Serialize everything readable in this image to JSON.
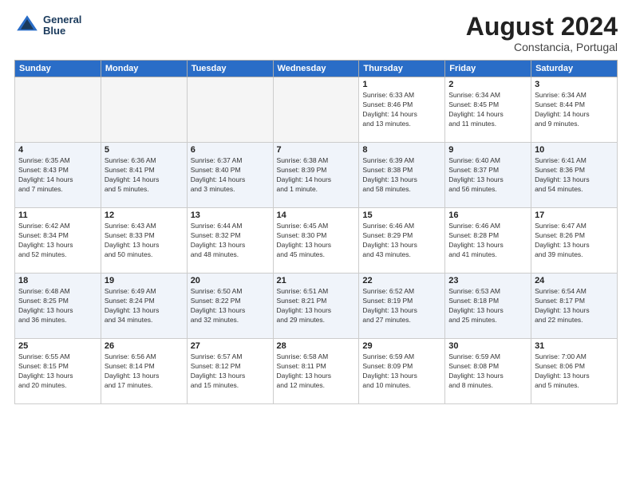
{
  "header": {
    "logo_line1": "General",
    "logo_line2": "Blue",
    "title": "August 2024",
    "location": "Constancia, Portugal"
  },
  "weekdays": [
    "Sunday",
    "Monday",
    "Tuesday",
    "Wednesday",
    "Thursday",
    "Friday",
    "Saturday"
  ],
  "weeks": [
    [
      {
        "day": "",
        "info": ""
      },
      {
        "day": "",
        "info": ""
      },
      {
        "day": "",
        "info": ""
      },
      {
        "day": "",
        "info": ""
      },
      {
        "day": "1",
        "info": "Sunrise: 6:33 AM\nSunset: 8:46 PM\nDaylight: 14 hours\nand 13 minutes."
      },
      {
        "day": "2",
        "info": "Sunrise: 6:34 AM\nSunset: 8:45 PM\nDaylight: 14 hours\nand 11 minutes."
      },
      {
        "day": "3",
        "info": "Sunrise: 6:34 AM\nSunset: 8:44 PM\nDaylight: 14 hours\nand 9 minutes."
      }
    ],
    [
      {
        "day": "4",
        "info": "Sunrise: 6:35 AM\nSunset: 8:43 PM\nDaylight: 14 hours\nand 7 minutes."
      },
      {
        "day": "5",
        "info": "Sunrise: 6:36 AM\nSunset: 8:41 PM\nDaylight: 14 hours\nand 5 minutes."
      },
      {
        "day": "6",
        "info": "Sunrise: 6:37 AM\nSunset: 8:40 PM\nDaylight: 14 hours\nand 3 minutes."
      },
      {
        "day": "7",
        "info": "Sunrise: 6:38 AM\nSunset: 8:39 PM\nDaylight: 14 hours\nand 1 minute."
      },
      {
        "day": "8",
        "info": "Sunrise: 6:39 AM\nSunset: 8:38 PM\nDaylight: 13 hours\nand 58 minutes."
      },
      {
        "day": "9",
        "info": "Sunrise: 6:40 AM\nSunset: 8:37 PM\nDaylight: 13 hours\nand 56 minutes."
      },
      {
        "day": "10",
        "info": "Sunrise: 6:41 AM\nSunset: 8:36 PM\nDaylight: 13 hours\nand 54 minutes."
      }
    ],
    [
      {
        "day": "11",
        "info": "Sunrise: 6:42 AM\nSunset: 8:34 PM\nDaylight: 13 hours\nand 52 minutes."
      },
      {
        "day": "12",
        "info": "Sunrise: 6:43 AM\nSunset: 8:33 PM\nDaylight: 13 hours\nand 50 minutes."
      },
      {
        "day": "13",
        "info": "Sunrise: 6:44 AM\nSunset: 8:32 PM\nDaylight: 13 hours\nand 48 minutes."
      },
      {
        "day": "14",
        "info": "Sunrise: 6:45 AM\nSunset: 8:30 PM\nDaylight: 13 hours\nand 45 minutes."
      },
      {
        "day": "15",
        "info": "Sunrise: 6:46 AM\nSunset: 8:29 PM\nDaylight: 13 hours\nand 43 minutes."
      },
      {
        "day": "16",
        "info": "Sunrise: 6:46 AM\nSunset: 8:28 PM\nDaylight: 13 hours\nand 41 minutes."
      },
      {
        "day": "17",
        "info": "Sunrise: 6:47 AM\nSunset: 8:26 PM\nDaylight: 13 hours\nand 39 minutes."
      }
    ],
    [
      {
        "day": "18",
        "info": "Sunrise: 6:48 AM\nSunset: 8:25 PM\nDaylight: 13 hours\nand 36 minutes."
      },
      {
        "day": "19",
        "info": "Sunrise: 6:49 AM\nSunset: 8:24 PM\nDaylight: 13 hours\nand 34 minutes."
      },
      {
        "day": "20",
        "info": "Sunrise: 6:50 AM\nSunset: 8:22 PM\nDaylight: 13 hours\nand 32 minutes."
      },
      {
        "day": "21",
        "info": "Sunrise: 6:51 AM\nSunset: 8:21 PM\nDaylight: 13 hours\nand 29 minutes."
      },
      {
        "day": "22",
        "info": "Sunrise: 6:52 AM\nSunset: 8:19 PM\nDaylight: 13 hours\nand 27 minutes."
      },
      {
        "day": "23",
        "info": "Sunrise: 6:53 AM\nSunset: 8:18 PM\nDaylight: 13 hours\nand 25 minutes."
      },
      {
        "day": "24",
        "info": "Sunrise: 6:54 AM\nSunset: 8:17 PM\nDaylight: 13 hours\nand 22 minutes."
      }
    ],
    [
      {
        "day": "25",
        "info": "Sunrise: 6:55 AM\nSunset: 8:15 PM\nDaylight: 13 hours\nand 20 minutes."
      },
      {
        "day": "26",
        "info": "Sunrise: 6:56 AM\nSunset: 8:14 PM\nDaylight: 13 hours\nand 17 minutes."
      },
      {
        "day": "27",
        "info": "Sunrise: 6:57 AM\nSunset: 8:12 PM\nDaylight: 13 hours\nand 15 minutes."
      },
      {
        "day": "28",
        "info": "Sunrise: 6:58 AM\nSunset: 8:11 PM\nDaylight: 13 hours\nand 12 minutes."
      },
      {
        "day": "29",
        "info": "Sunrise: 6:59 AM\nSunset: 8:09 PM\nDaylight: 13 hours\nand 10 minutes."
      },
      {
        "day": "30",
        "info": "Sunrise: 6:59 AM\nSunset: 8:08 PM\nDaylight: 13 hours\nand 8 minutes."
      },
      {
        "day": "31",
        "info": "Sunrise: 7:00 AM\nSunset: 8:06 PM\nDaylight: 13 hours\nand 5 minutes."
      }
    ]
  ],
  "row_classes": [
    "row-white",
    "row-blue",
    "row-white",
    "row-blue",
    "row-white"
  ]
}
